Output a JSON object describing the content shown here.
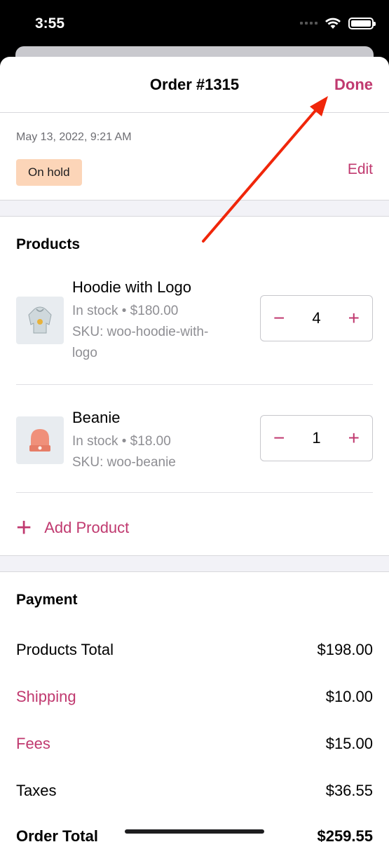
{
  "status_bar": {
    "time": "3:55"
  },
  "nav": {
    "title": "Order #1315",
    "done_label": "Done"
  },
  "order": {
    "date": "May 13, 2022, 9:21 AM",
    "status": "On hold",
    "edit_label": "Edit"
  },
  "products": {
    "title": "Products",
    "items": [
      {
        "name": "Hoodie with Logo",
        "stock_price": "In stock • $180.00",
        "sku": "SKU: woo-hoodie-with-logo",
        "quantity": "4",
        "icon": "hoodie-icon"
      },
      {
        "name": "Beanie",
        "stock_price": "In stock • $18.00",
        "sku": "SKU: woo-beanie",
        "quantity": "1",
        "icon": "beanie-icon"
      }
    ],
    "add_label": "Add Product",
    "minus": "−",
    "plus": "+"
  },
  "payment": {
    "title": "Payment",
    "rows": [
      {
        "label": "Products Total",
        "value": "$198.00"
      },
      {
        "label": "Shipping",
        "value": "$10.00"
      },
      {
        "label": "Fees",
        "value": "$15.00"
      },
      {
        "label": "Taxes",
        "value": "$36.55"
      },
      {
        "label": "Order Total",
        "value": "$259.55"
      }
    ]
  },
  "colors": {
    "accent": "#c0396f",
    "badge": "#fcd5b8",
    "annotation_arrow": "#f0260a"
  }
}
